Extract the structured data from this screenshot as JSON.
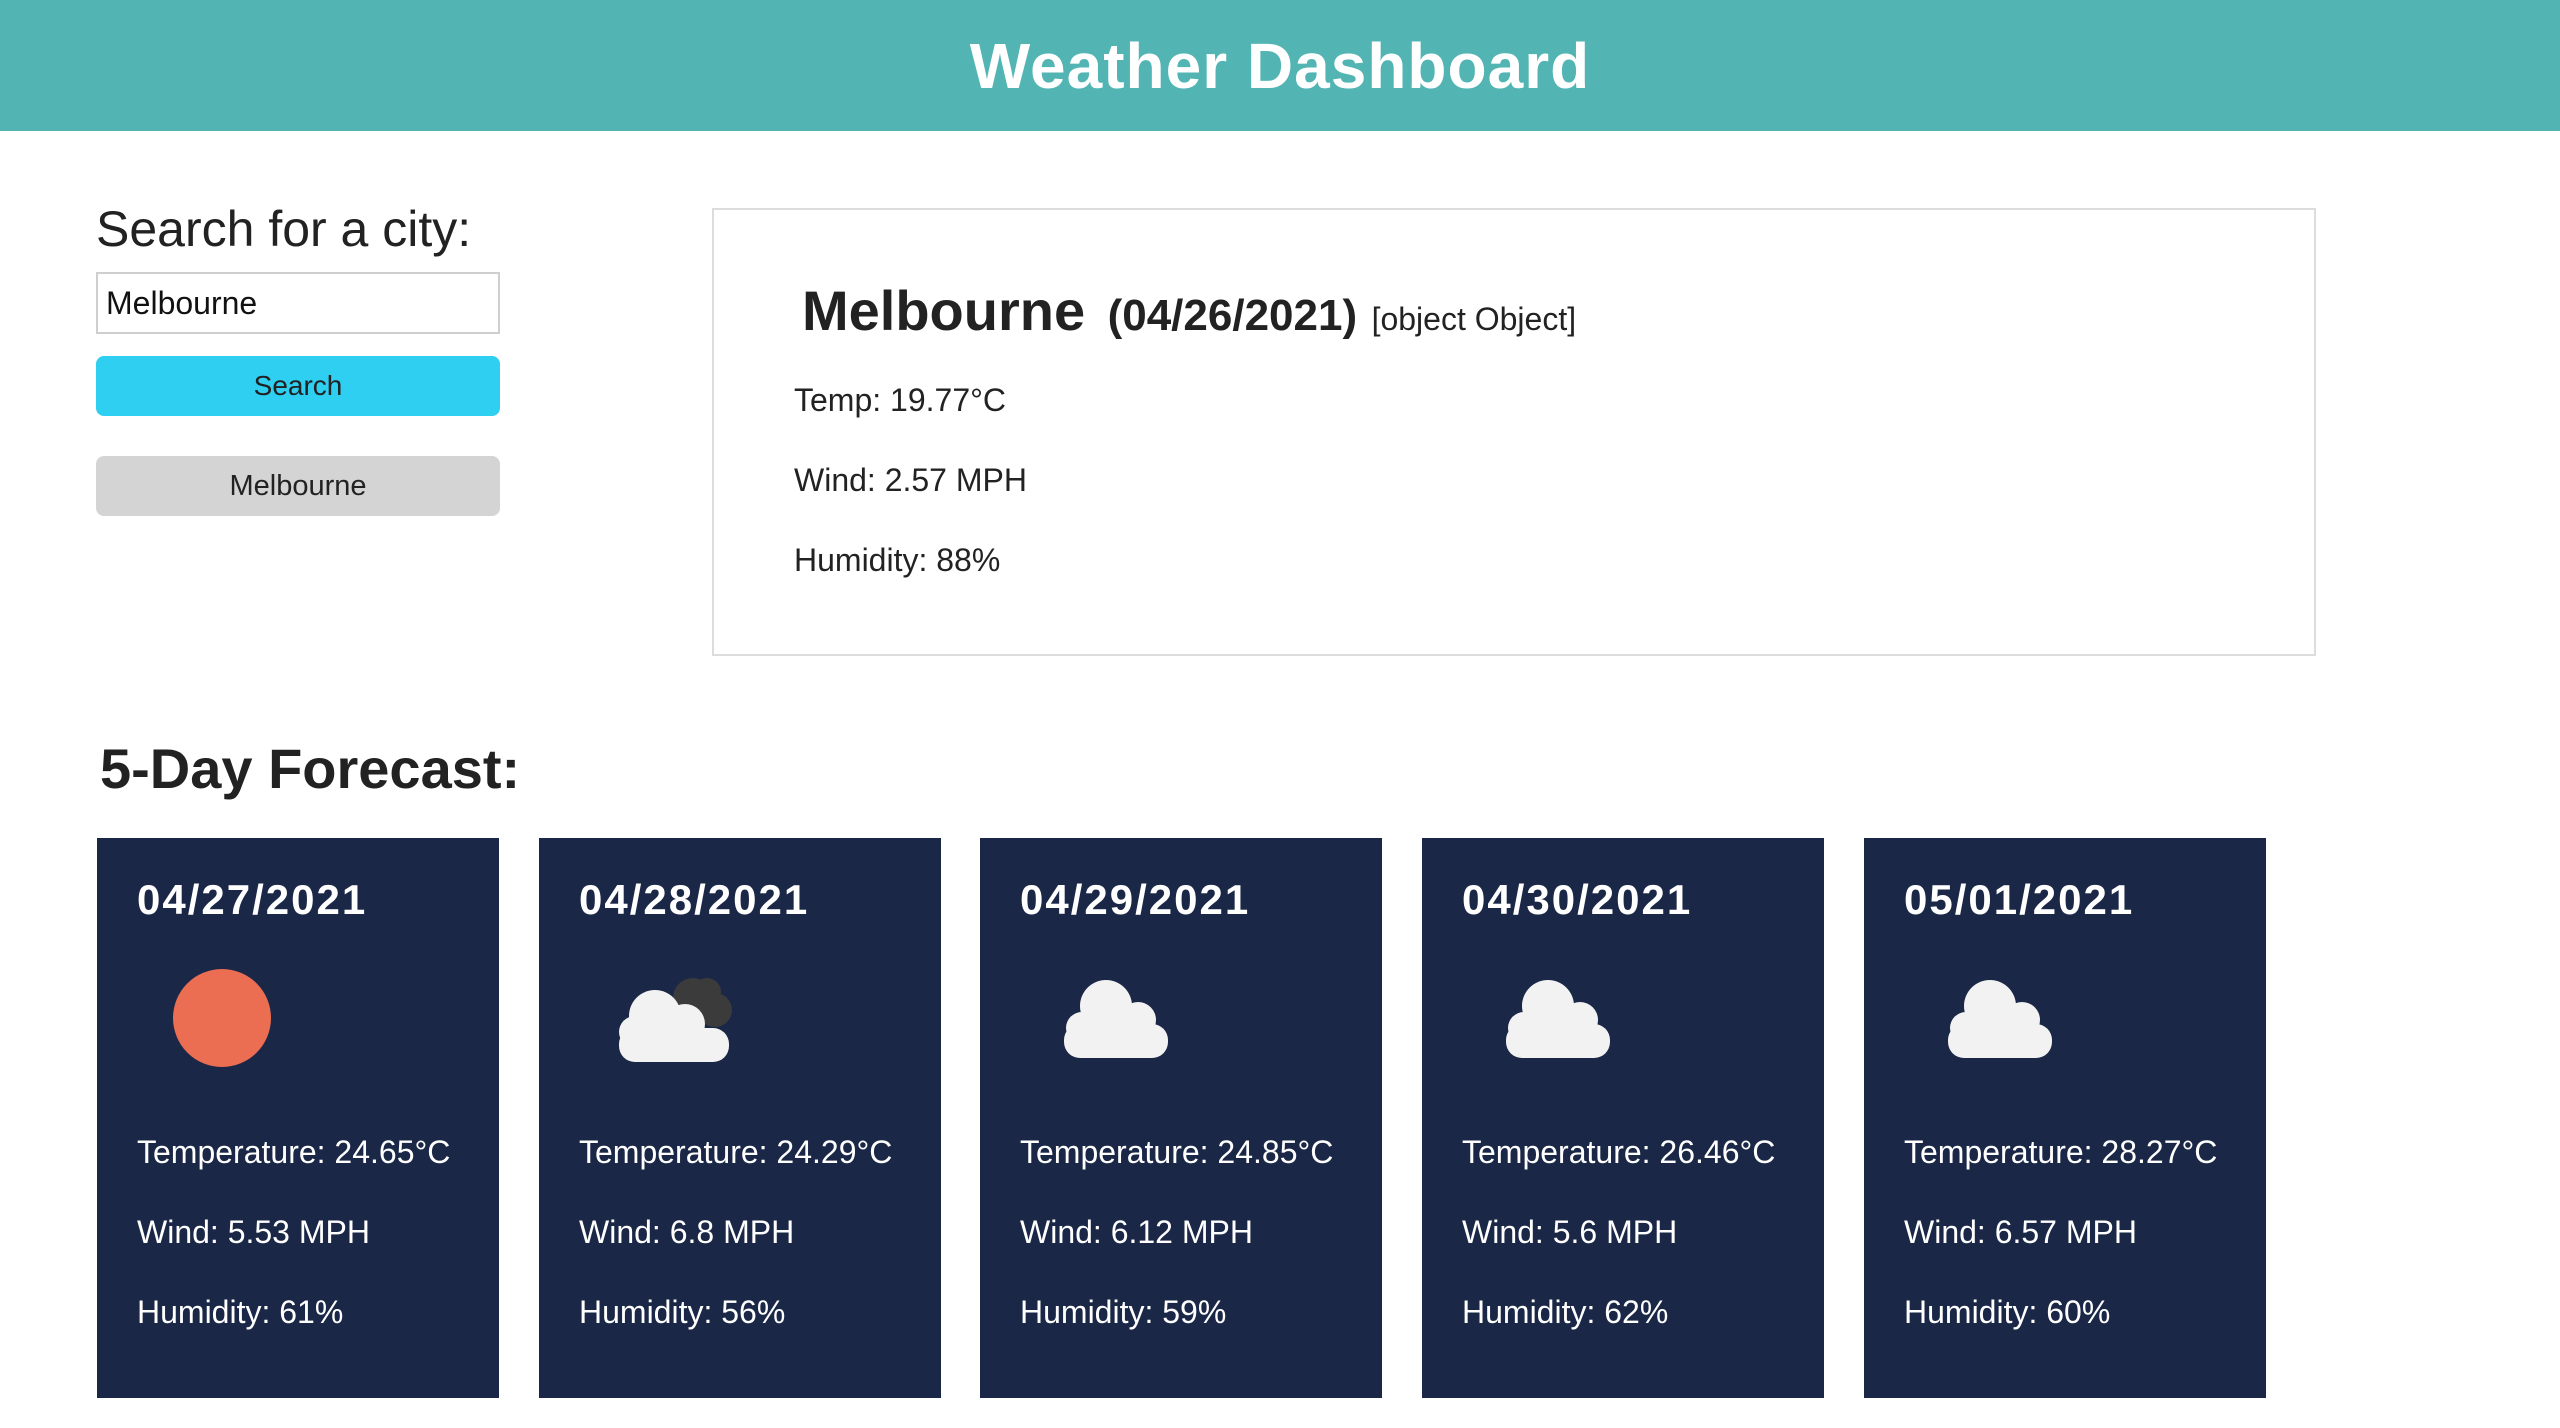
{
  "header": {
    "title": "Weather Dashboard"
  },
  "search": {
    "title": "Search for a city:",
    "input_value": "Melbourne",
    "button_label": "Search",
    "history": [
      "Melbourne"
    ]
  },
  "current": {
    "city": "Melbourne",
    "date": "(04/26/2021)",
    "icon_text": "[object Object]",
    "temp": "Temp: 19.77°C",
    "wind": "Wind: 2.57 MPH",
    "humidity": "Humidity: 88%"
  },
  "forecast": {
    "title": "5-Day Forecast:",
    "days": [
      {
        "date": "04/27/2021",
        "icon": "sun-icon",
        "temperature": "Temperature: 24.65°C",
        "wind": "Wind: 5.53 MPH",
        "humidity": "Humidity: 61%"
      },
      {
        "date": "04/28/2021",
        "icon": "partly-cloudy-icon",
        "temperature": "Temperature: 24.29°C",
        "wind": "Wind: 6.8 MPH",
        "humidity": "Humidity: 56%"
      },
      {
        "date": "04/29/2021",
        "icon": "cloud-icon",
        "temperature": "Temperature: 24.85°C",
        "wind": "Wind: 6.12 MPH",
        "humidity": "Humidity: 59%"
      },
      {
        "date": "04/30/2021",
        "icon": "cloud-icon",
        "temperature": "Temperature: 26.46°C",
        "wind": "Wind: 5.6 MPH",
        "humidity": "Humidity: 62%"
      },
      {
        "date": "05/01/2021",
        "icon": "cloud-icon",
        "temperature": "Temperature: 28.27°C",
        "wind": "Wind: 6.57 MPH",
        "humidity": "Humidity: 60%"
      }
    ]
  },
  "colors": {
    "header_bg": "#52b5b3",
    "search_button": "#2ecff0",
    "history_button": "#d4d4d4",
    "forecast_card": "#1a2747",
    "sun": "#ec6e52"
  }
}
